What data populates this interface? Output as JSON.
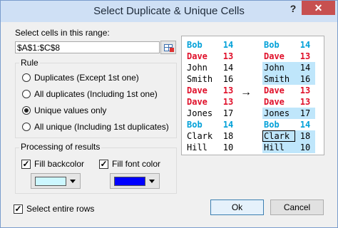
{
  "window": {
    "title": "Select Duplicate & Unique Cells",
    "help_label": "?",
    "close_label": "✕"
  },
  "range": {
    "label": "Select cells in this range:",
    "value": "$A$1:$C$8"
  },
  "rule": {
    "title": "Rule",
    "options": [
      {
        "label": "Duplicates (Except 1st one)",
        "checked": false
      },
      {
        "label": "All duplicates (Including 1st one)",
        "checked": false
      },
      {
        "label": "Unique values only",
        "checked": true
      },
      {
        "label": "All unique (Including 1st duplicates)",
        "checked": false
      }
    ]
  },
  "processing": {
    "title": "Processing of results",
    "fill_backcolor": {
      "label": "Fill backcolor",
      "checked": true,
      "color": "#ccf7ff"
    },
    "fill_fontcolor": {
      "label": "Fill font color",
      "checked": true,
      "color": "#0000ff"
    }
  },
  "select_entire_rows": {
    "label": "Select entire rows",
    "checked": true
  },
  "preview": {
    "before": [
      {
        "name": "Bob",
        "value": "14",
        "style": "blue"
      },
      {
        "name": "Dave",
        "value": "13",
        "style": "red"
      },
      {
        "name": "John",
        "value": "14",
        "style": "black"
      },
      {
        "name": "Smith",
        "value": "16",
        "style": "black"
      },
      {
        "name": "Dave",
        "value": "13",
        "style": "red"
      },
      {
        "name": "Dave",
        "value": "13",
        "style": "red"
      },
      {
        "name": "Jones",
        "value": "17",
        "style": "black"
      },
      {
        "name": "Bob",
        "value": "14",
        "style": "blue"
      },
      {
        "name": "Clark",
        "value": "18",
        "style": "black"
      },
      {
        "name": "Hill",
        "value": "10",
        "style": "black"
      }
    ],
    "after": [
      {
        "name": "Bob",
        "value": "14",
        "style": "blue",
        "highlight": false
      },
      {
        "name": "Dave",
        "value": "13",
        "style": "red",
        "highlight": false
      },
      {
        "name": "John",
        "value": "14",
        "style": "black",
        "highlight": true
      },
      {
        "name": "Smith",
        "value": "16",
        "style": "black",
        "highlight": true
      },
      {
        "name": "Dave",
        "value": "13",
        "style": "red",
        "highlight": false
      },
      {
        "name": "Dave",
        "value": "13",
        "style": "red",
        "highlight": false
      },
      {
        "name": "Jones",
        "value": "17",
        "style": "black",
        "highlight": true
      },
      {
        "name": "Bob",
        "value": "14",
        "style": "blue",
        "highlight": false
      },
      {
        "name": "Clark",
        "value": "18",
        "style": "black",
        "highlight": true
      },
      {
        "name": "Hill",
        "value": "10",
        "style": "black",
        "highlight": true
      }
    ],
    "arrow": "→"
  },
  "buttons": {
    "ok": "Ok",
    "cancel": "Cancel"
  }
}
